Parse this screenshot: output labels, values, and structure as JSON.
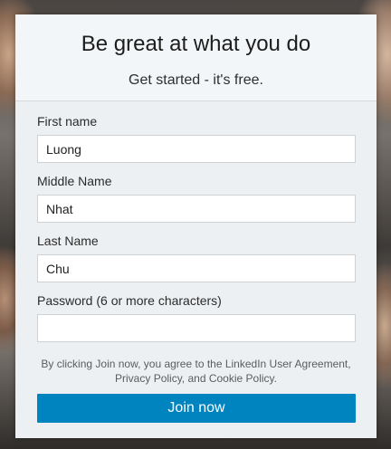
{
  "header": {
    "headline": "Be great at what you do",
    "subheadline": "Get started - it's free."
  },
  "form": {
    "fields": [
      {
        "label": "First name",
        "value": "Luong",
        "type": "text"
      },
      {
        "label": "Middle Name",
        "value": "Nhat",
        "type": "text"
      },
      {
        "label": "Last Name",
        "value": "Chu",
        "type": "text"
      },
      {
        "label": "Password (6 or more characters)",
        "value": "",
        "type": "password"
      }
    ],
    "agreement_text": "By clicking Join now, you agree to the LinkedIn User Agreement, Privacy Policy, and Cookie Policy.",
    "submit_label": "Join now"
  },
  "colors": {
    "accent": "#0084bf",
    "card_bg": "#f3f6f8",
    "body_bg": "#edf0f3"
  }
}
